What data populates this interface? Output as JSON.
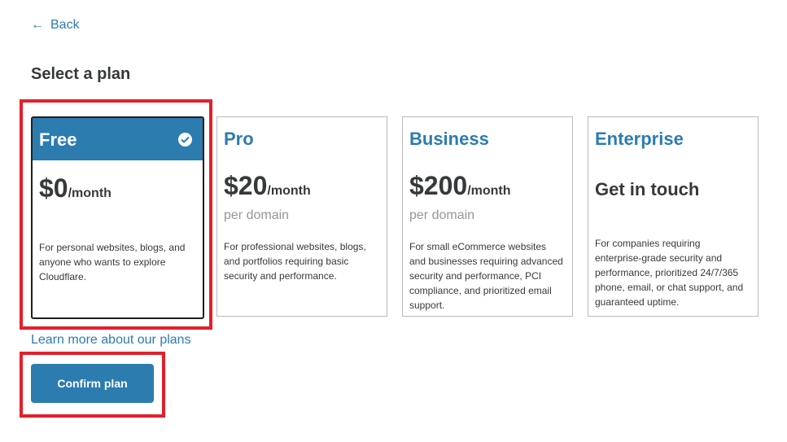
{
  "back": {
    "label": "Back"
  },
  "title": "Select a plan",
  "plans": [
    {
      "name": "Free",
      "price": "$0",
      "per": "/month",
      "subprice": "",
      "description": "For personal websites, blogs, and anyone who wants to explore Cloudflare.",
      "selected": true
    },
    {
      "name": "Pro",
      "price": "$20",
      "per": "/month",
      "subprice": "per domain",
      "description": "For professional websites, blogs, and portfolios requiring basic security and performance.",
      "selected": false
    },
    {
      "name": "Business",
      "price": "$200",
      "per": "/month",
      "subprice": "per domain",
      "description": "For small eCommerce websites and businesses requiring advanced security and performance, PCI compliance, and prioritized email support.",
      "selected": false
    },
    {
      "name": "Enterprise",
      "price": "Get in touch",
      "per": "",
      "subprice": "",
      "description": "For companies requiring enterprise-grade security and performance, prioritized 24/7/365 phone, email, or chat support, and guaranteed uptime.",
      "selected": false
    }
  ],
  "learn_more": "Learn more about our plans",
  "confirm": "Confirm plan",
  "colors": {
    "accent": "#2c7cb0",
    "highlight": "#e2202b",
    "text": "#36393a",
    "muted": "#92979b"
  },
  "icons": {
    "back": "left-arrow-icon",
    "selected": "check-circle-icon"
  }
}
